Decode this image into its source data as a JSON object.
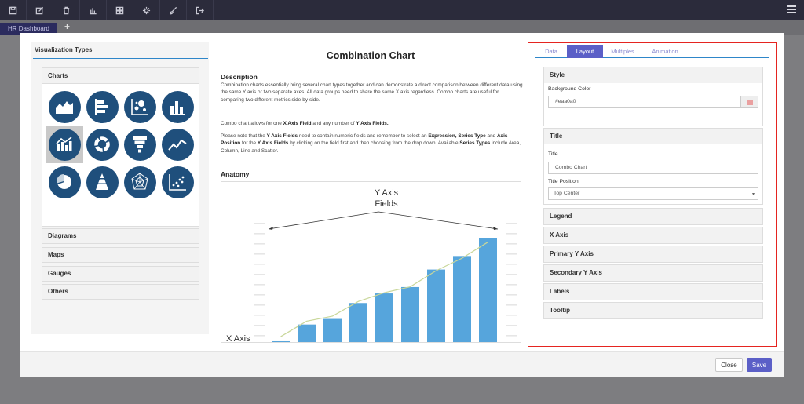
{
  "toolbar": {
    "icons": [
      "save-icon",
      "edit-icon",
      "trash-icon",
      "bar-chart-icon",
      "grid-icon",
      "gear-icon",
      "brush-icon",
      "logout-icon"
    ],
    "menu_icon": "hamburger-icon"
  },
  "tabs": {
    "active_tab": "HR Dashboard",
    "add_icon": "+"
  },
  "left_panel": {
    "title": "Visualization Types",
    "charts_header": "Charts",
    "chart_icons": [
      "area-chart-icon",
      "horizontal-bar-icon",
      "bubble-chart-icon",
      "column-chart-icon",
      "combination-chart-icon",
      "donut-chart-icon",
      "funnel-chart-icon",
      "line-chart-icon",
      "pie-chart-icon",
      "pyramid-chart-icon",
      "radar-chart-icon",
      "scatter-chart-icon"
    ],
    "selected_chart": "combination-chart-icon",
    "categories": [
      "Diagrams",
      "Maps",
      "Gauges",
      "Others"
    ]
  },
  "middle": {
    "title": "Combination Chart",
    "description_heading": "Description",
    "description_p1": "Combination charts essentially bring several chart types together and can demonstrate a direct comparison between different data using the same Y axis or two separate axes. All data groups need to share the same X axis regardless. Combo charts are useful for comparing two different metrics side-by-side.",
    "p2_a": "Combo chart allows for one ",
    "p2_b": "X Axis Field",
    "p2_c": " and any number of ",
    "p2_d": "Y Axis Fields.",
    "p3_a": "Please note that the ",
    "p3_b": "Y Axis Fields",
    "p3_c": " need to contain numeric fields and remember to select an ",
    "p3_d": "Expression, Series Type",
    "p3_e": " and ",
    "p3_f": "Axis Position",
    "p3_g": " for the ",
    "p3_h": "Y Axis Fields",
    "p3_i": " by clicking on the field first and then choosing from the drop down. Available ",
    "p3_j": "Series Types",
    "p3_k": " include Area, Column, Line and Scatter.",
    "anatomy_heading": "Anatomy",
    "anatomy_y_label_1": "Y Axis",
    "anatomy_y_label_2": "Fields",
    "anatomy_x_label": "X Axis",
    "anatomy_bars": [
      1,
      22,
      29,
      49,
      61,
      69,
      91,
      108,
      130
    ],
    "anatomy_bar_max": 130
  },
  "right_panel": {
    "tabs": [
      "Data",
      "Layout",
      "Multiples",
      "Animation"
    ],
    "active_tab": "Layout",
    "style_header": "Style",
    "background_color_label": "Background Color",
    "background_color_value": "#eaa0a0",
    "swatch_color": "#eaa0a0",
    "title_header": "Title",
    "title_label": "Title",
    "title_value": "Combo Chart",
    "title_position_label": "Title Position",
    "title_position_value": "Top Center",
    "sections": [
      "Legend",
      "X Axis",
      "Primary Y Axis",
      "Secondary Y Axis",
      "Labels",
      "Tooltip"
    ]
  },
  "footer": {
    "close_label": "Close",
    "save_label": "Save"
  },
  "colors": {
    "accent": "#5b5fc7",
    "highlight": "#e52420",
    "icon_bg": "#1f4f7c",
    "bar": "#56a5dc"
  }
}
